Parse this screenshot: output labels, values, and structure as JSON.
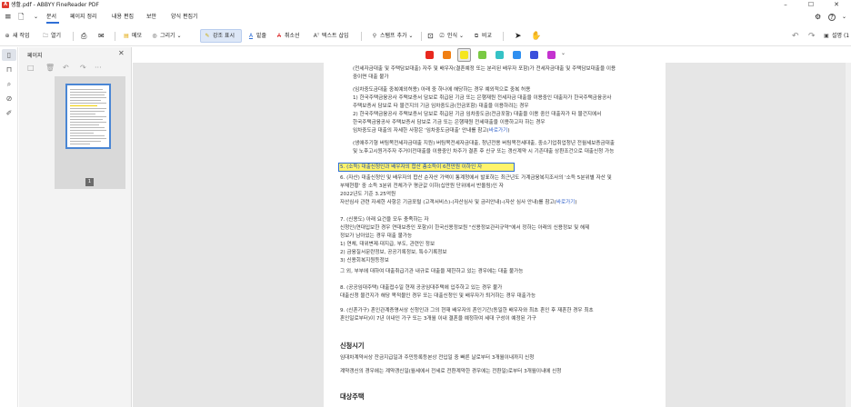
{
  "window": {
    "title": "생활.pdf - ABBYY FineReader PDF",
    "app_icon_letter": "A",
    "minimize": "–",
    "maximize": "☐",
    "close": "✕"
  },
  "menubar": {
    "hamburger": "≡",
    "file_icon": "🗋",
    "items": [
      "문서",
      "페이지 정리",
      "내용 편집",
      "보안",
      "양식 편집기"
    ],
    "settings_icon": "⚙",
    "help_icon": "?",
    "more_icon": "⌄"
  },
  "toolbar": {
    "new_task": "새 작업",
    "open": "열기",
    "note": "메모",
    "draw": "그리기",
    "highlight": "강조 표시",
    "underline": "밑줄",
    "strikethrough": "취소선",
    "insert_text": "텍스트 삽입",
    "stamp_add": "스탬프 추가",
    "recognize": "인식",
    "compare": "비교",
    "undo": "↶",
    "redo": "↷",
    "settings": "설명 (1"
  },
  "colors": {
    "swatches": [
      "#e8281e",
      "#f07f13",
      "#f5e620",
      "#7ac943",
      "#35c2c6",
      "#2f8ff0",
      "#3a4fdc",
      "#c433cf"
    ],
    "selected": "#f5e620",
    "accent": "#2f6fd6"
  },
  "panel": {
    "title": "페이지",
    "close": "✕",
    "page_number": "1",
    "tools": [
      "□",
      "🗑",
      "↶",
      "↷",
      "···"
    ]
  },
  "document": {
    "lines": [
      {
        "text": "(전세자금대출 및 주택담보대출) 자주 및 배우자(결혼예정 또는 분리된 배우자 포함)가 전세자금대출 및 주택담보대출을 이용",
        "link": ""
      },
      {
        "text": "중이면 대출 불가",
        "link": ""
      },
      {
        "text": "(임차중도금대출 중복예외허용) 아래 중 하나에 해당하는 경우 예외적으로 중복 허용",
        "link": ""
      },
      {
        "text": "1) 한국주택금융공사 주택보증서 담보로 취급된 기금 또는 은행재원 전세자금 대출을 이용중인 대출자가 한국주택금융공사",
        "link": ""
      },
      {
        "text": "주택보증서 담보로 타 물건지의 기금 임차중도금(전금포함) 대출을 이용하려는 경우",
        "link": ""
      },
      {
        "text": "2) 한국주택금융공사 주택보증서 담보로 취급된 기금 임차중도금(전금포함) 대출을 이용 중인 대출자가 타 물건지에서",
        "link": ""
      },
      {
        "text": "한국주택금융공사 주택보증서 담보로 기금 또는 은행재원 전세대출을 이용하고자 하는 경우",
        "link": ""
      },
      {
        "text": "  임차중도금 대출의 자세한 사항은 '임차중도금대출' 안내를 참고(",
        "link": "바로가기"
      },
      {
        "text": "(생애주기형 버팀목전세자금대출 지원) 버팀목전세자금대출, 청년전용 버팀목전세대출, 중소기업취업청년 전월세보증금대출",
        "link": ""
      },
      {
        "text": "및 노후고시원거주자 주거이전대출을 이용중인 차주가 결혼 후 신규 또는 갱신계약 시 기존대출 상환조건으로 대출신청 가능",
        "link": ""
      }
    ],
    "highlighted": "5. (소득) 대출신청인과 배우자의 합산 총소득이 6천만원 이하인 자",
    "lines2": [
      {
        "text": "6. (자산) 대출신청인 및 배우자의 합산 순자산 가액이 통계청에서 발표하는 최근년도 가계금융복지조사의 '소득 5분위별 자산 및",
        "link": ""
      },
      {
        "text": "부채현황' 중 소득 3분위 전체가구 평균값 이하(십만원 단위에서 반올림)인 자",
        "link": ""
      },
      {
        "text": "  2022년도 기준 3.25억원",
        "link": ""
      },
      {
        "text": "  자산심사 관련 자세한 사항은 기금포털 (고객서비스)-(자산심사 및 금리안내)-(자산 심사 안내)를 참고(",
        "link": "바로가기"
      },
      {
        "text": "7. (신용도) 아래 요건을 모두 충족하는 자",
        "link": ""
      },
      {
        "text": "  신청인(연대입보한 경우 연대보증인 포함)이 한국신용정보원 \"신용정보관리규약\"에서 정하는 아래의 신용정보 및 해제",
        "link": ""
      },
      {
        "text": "  정보가 남아있는 경우 대출 불가능",
        "link": ""
      },
      {
        "text": "  1) 연체, 대위변제·대지급, 부도, 관련인 정보",
        "link": ""
      },
      {
        "text": "  2) 금융질서문란정보, 공공기록정보, 특수기록정보",
        "link": ""
      },
      {
        "text": "  3) 신용회복지원등정보",
        "link": ""
      },
      {
        "text": "  그 외, 부부에 대하여 대출취급기관 내규로 대출을 제한하고 있는 경우에는 대출 불가능",
        "link": ""
      },
      {
        "text": "8. (공공임대주택) 대출접수일 현재 공공임대주택에 입주하고 있는 경우 불가",
        "link": ""
      },
      {
        "text": "  대출신청 물건지가 해당 목적물인 경우 또는 대출신청인 및 배우자가 퇴거하는 경우 대출가능",
        "link": ""
      },
      {
        "text": "9. (신혼가구) 혼인관계증명서상 신청인과 그의 현재 배우자의 혼인기간(동일한 배우자와 최초 혼인 후 재혼한 경우 최초",
        "link": ""
      },
      {
        "text": "혼인일로부터)이 7년 이내인 가구 또는 3개월 이내 결혼을 예정하여 세대 구성이 예정된 가구",
        "link": ""
      }
    ],
    "section1_title": "신청시기",
    "section1_lines": [
      "임대차계약서상 잔금지급일과 주민등록등본상 전입일 중 빠른 날로부터 3개월이내까지 신청",
      "계약갱신의 경우에는 계약갱신일(월세에서 전세로 전환계약한 경우에는 전환일)로부터 3개월이내에 신청"
    ],
    "section2_title": "대상주택"
  }
}
